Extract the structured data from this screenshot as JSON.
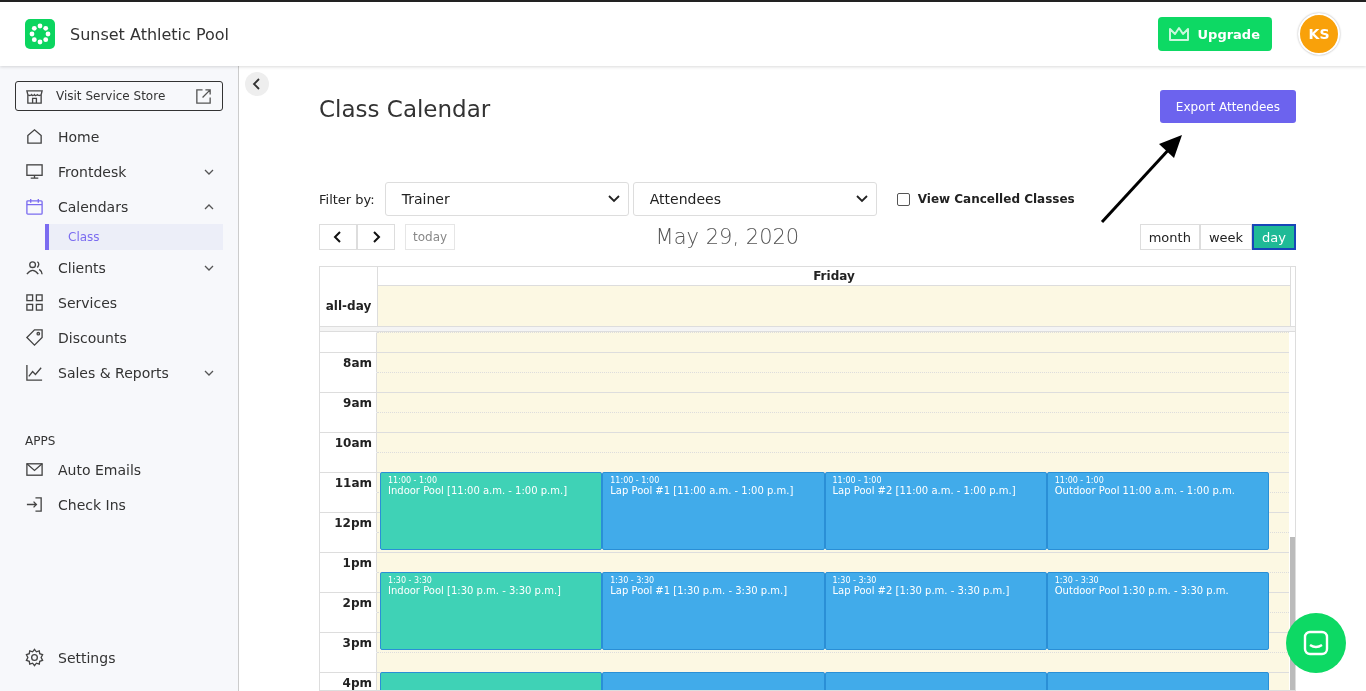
{
  "header": {
    "brand": "Sunset Athletic Pool",
    "upgrade": "Upgrade",
    "avatar": "KS"
  },
  "sidebar": {
    "store": "Visit Service Store",
    "items": [
      {
        "label": "Home"
      },
      {
        "label": "Frontdesk",
        "expanded": false
      },
      {
        "label": "Calendars",
        "expanded": true,
        "children": [
          {
            "label": "Class",
            "selected": true
          }
        ]
      },
      {
        "label": "Clients",
        "expanded": false
      },
      {
        "label": "Services"
      },
      {
        "label": "Discounts"
      },
      {
        "label": "Sales & Reports",
        "expanded": false
      }
    ],
    "apps_heading": "APPS",
    "apps": [
      {
        "label": "Auto Emails"
      },
      {
        "label": "Check Ins"
      }
    ],
    "settings": "Settings"
  },
  "page": {
    "title": "Class Calendar",
    "export": "Export Attendees",
    "filter_label": "Filter by:",
    "filters": [
      "Trainer",
      "Attendees"
    ],
    "cancelled": {
      "label": "View Cancelled Classes",
      "checked": false
    },
    "today": "today",
    "date": "May 29, 2020",
    "views": [
      {
        "label": "month",
        "selected": false
      },
      {
        "label": "week",
        "selected": false
      },
      {
        "label": "day",
        "selected": true
      }
    ]
  },
  "calendar": {
    "day": "Friday",
    "allday": "all-day",
    "hours": [
      "8am",
      "9am",
      "10am",
      "11am",
      "12pm",
      "1pm",
      "2pm",
      "3pm",
      "4pm"
    ],
    "event_rows": [
      {
        "events": [
          {
            "time": "11:00 - 1:00",
            "title": "Indoor Pool [11:00 a.m. - 1:00 p.m.]",
            "color": "#3fd2b6"
          },
          {
            "time": "11:00 - 1:00",
            "title": "Lap Pool #1 [11:00 a.m. - 1:00 p.m.]",
            "color": "#41abea"
          },
          {
            "time": "11:00 - 1:00",
            "title": "Lap Pool #2 [11:00 a.m. - 1:00 p.m.]",
            "color": "#41abea"
          },
          {
            "time": "11:00 - 1:00",
            "title": "Outdoor Pool 11:00 a.m. - 1:00 p.m.",
            "color": "#41abea"
          }
        ]
      },
      {
        "events": [
          {
            "time": "1:30 - 3:30",
            "title": "Indoor Pool [1:30 p.m. - 3:30 p.m.]",
            "color": "#3fd2b6"
          },
          {
            "time": "1:30 - 3:30",
            "title": "Lap Pool #1 [1:30 p.m. - 3:30 p.m.]",
            "color": "#41abea"
          },
          {
            "time": "1:30 - 3:30",
            "title": "Lap Pool #2 [1:30 p.m. - 3:30 p.m.]",
            "color": "#41abea"
          },
          {
            "time": "1:30 - 3:30",
            "title": "Outdoor Pool 1:30 p.m. - 3:30 p.m.",
            "color": "#41abea"
          }
        ]
      },
      {
        "events": [
          {
            "color": "#3fd2b6"
          },
          {
            "color": "#41abea"
          },
          {
            "color": "#41abea"
          },
          {
            "color": "#41abea"
          }
        ]
      }
    ]
  }
}
